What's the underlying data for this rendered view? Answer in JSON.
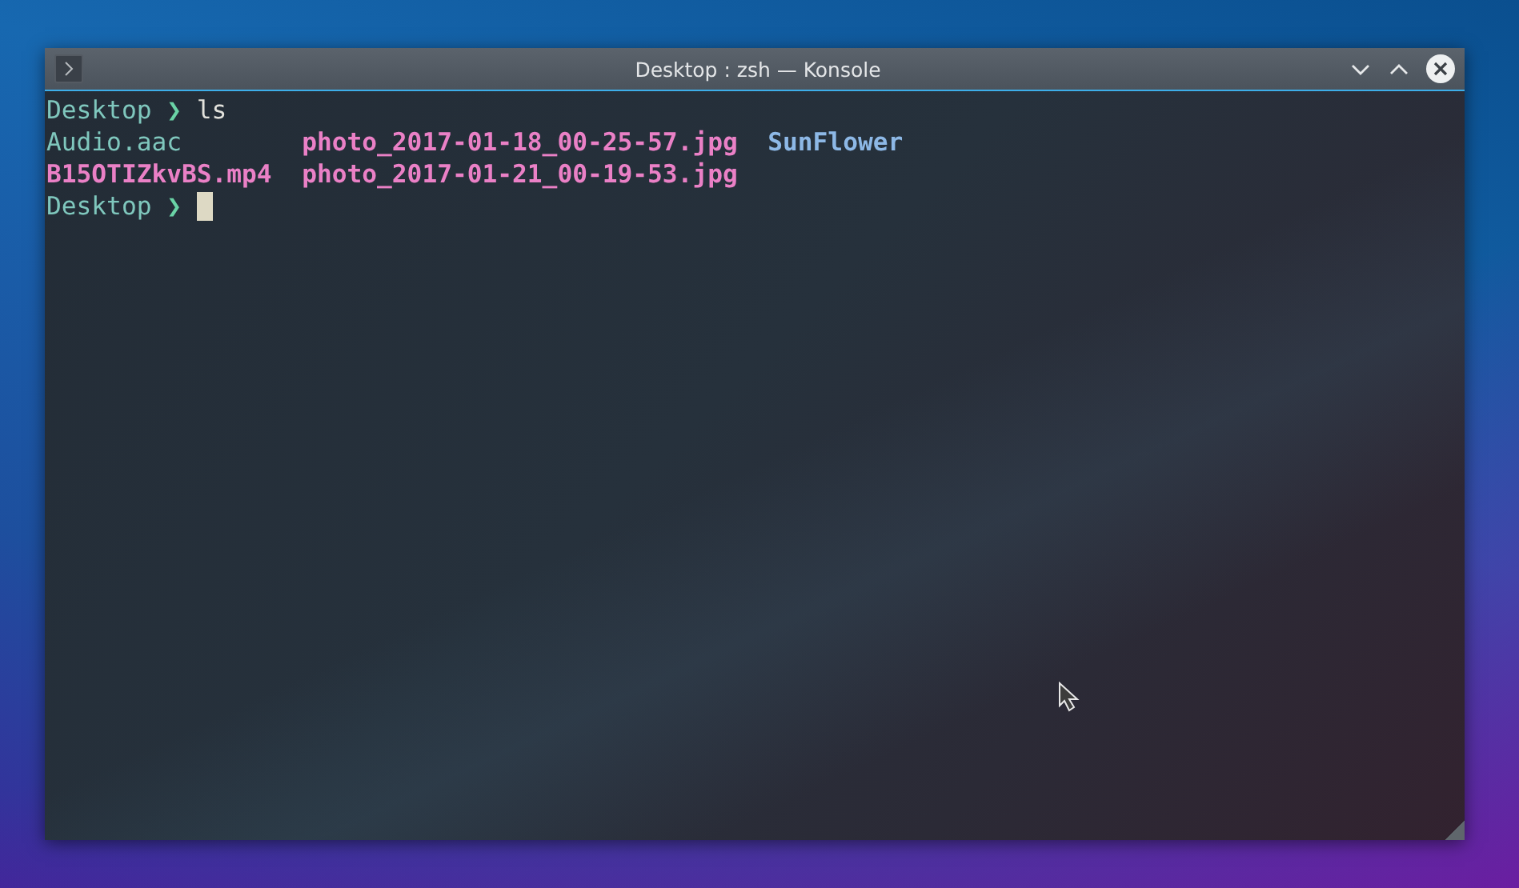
{
  "window": {
    "title": "Desktop : zsh — Konsole"
  },
  "terminal": {
    "lines": [
      {
        "kind": "prompt",
        "directory": "Desktop",
        "arrow": "❯",
        "command": "ls",
        "cursor": false
      },
      {
        "kind": "listing",
        "columns": [
          [
            {
              "name": "Audio.aac",
              "kind": "file"
            },
            {
              "name": "B15OTIZkvBS.mp4",
              "kind": "media"
            }
          ],
          [
            {
              "name": "photo_2017-01-18_00-25-57.jpg",
              "kind": "media"
            },
            {
              "name": "photo_2017-01-21_00-19-53.jpg",
              "kind": "media"
            }
          ],
          [
            {
              "name": "SunFlower",
              "kind": "directory"
            }
          ]
        ]
      },
      {
        "kind": "prompt",
        "directory": "Desktop",
        "arrow": "❯",
        "cursor": true
      }
    ]
  }
}
